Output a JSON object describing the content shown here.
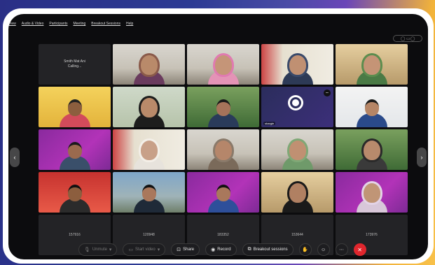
{
  "menu": [
    "View",
    "Audio & Video",
    "Participants",
    "Meeting",
    "Breakout Sessions",
    "Help"
  ],
  "view_toggle": "◯ ▭◯",
  "tiles": [
    {
      "kind": "name",
      "name": "Smith Mat Ani",
      "sub": "Calling...",
      "bg": "bg-dark"
    },
    {
      "kind": "person",
      "bg": "bg-room",
      "skin": "#b98a6a",
      "top": "#6a3b5e",
      "hijab": true,
      "tone": "#8a5a4a"
    },
    {
      "kind": "person",
      "bg": "bg-room",
      "skin": "#c59578",
      "top": "#e493b6",
      "hijab": true,
      "tone": "#e07ab0"
    },
    {
      "kind": "person",
      "bg": "bg-shelf",
      "skin": "#c09072",
      "top": "#2d3a56",
      "hijab": true,
      "tone": "#3a4a6a"
    },
    {
      "kind": "person",
      "bg": "bg-warm",
      "skin": "#c59476",
      "top": "#4a7a45",
      "hijab": true,
      "tone": "#5c8d4e"
    },
    {
      "kind": "person",
      "bg": "bg-yellow",
      "skin": "#8c5e3e",
      "top": "#d24b5b",
      "hijab": false,
      "tone": "#222"
    },
    {
      "kind": "person",
      "bg": "bg-office",
      "skin": "#b98a6a",
      "top": "#1d1d1d",
      "hijab": true,
      "tone": "#1d1d1d"
    },
    {
      "kind": "person",
      "bg": "bg-green",
      "skin": "#a6735a",
      "top": "#2a3b5a",
      "hijab": false,
      "tone": "#1a1a1a"
    },
    {
      "kind": "obs",
      "bg": "bg-dark",
      "tag": "shargie"
    },
    {
      "kind": "person",
      "bg": "bg-bike",
      "skin": "#b58566",
      "top": "#2a4a8a",
      "hijab": false,
      "tone": "#1a1a1a"
    },
    {
      "kind": "person",
      "bg": "bg-purple",
      "skin": "#9b6a4e",
      "top": "#3a4f6a",
      "hijab": false,
      "tone": "#1a1a1a"
    },
    {
      "kind": "person",
      "bg": "bg-shelf",
      "skin": "#c8a088",
      "top": "#e7e3dc",
      "hijab": true,
      "tone": "#f3efe8"
    },
    {
      "kind": "person",
      "bg": "bg-room",
      "skin": "#b5866a",
      "top": "#7a6a5a",
      "hijab": true,
      "tone": "#8a7a6a"
    },
    {
      "kind": "person",
      "bg": "bg-room",
      "skin": "#c09072",
      "top": "#6f9a6a",
      "hijab": true,
      "tone": "#7fa876"
    },
    {
      "kind": "person",
      "bg": "bg-green",
      "skin": "#b88a6c",
      "top": "#3a3a3a",
      "hijab": true,
      "tone": "#2a2a2a"
    },
    {
      "kind": "person",
      "bg": "bg-red",
      "skin": "#8c5e3e",
      "top": "#2b2b2b",
      "hijab": false,
      "tone": "#111"
    },
    {
      "kind": "person",
      "bg": "bg-sky",
      "skin": "#a9785c",
      "top": "#1f2a38",
      "hijab": false,
      "tone": "#111"
    },
    {
      "kind": "person",
      "bg": "bg-purple",
      "skin": "#a9785c",
      "top": "#2e4f9a",
      "hijab": false,
      "tone": "#111"
    },
    {
      "kind": "person",
      "bg": "bg-warm",
      "skin": "#b08062",
      "top": "#1a1a1a",
      "hijab": true,
      "tone": "#1a1a1a"
    },
    {
      "kind": "person",
      "bg": "bg-purple",
      "skin": "#c09576",
      "top": "#d8c7d9",
      "hijab": true,
      "tone": "#e3d3e6"
    },
    {
      "kind": "num",
      "num": "157916"
    },
    {
      "kind": "num",
      "num": "120948"
    },
    {
      "kind": "num",
      "num": "183352"
    },
    {
      "kind": "num",
      "num": "153644"
    },
    {
      "kind": "num",
      "num": "173976"
    }
  ],
  "toolbar": {
    "mute": "Unmute",
    "video": "Start video",
    "share": "Share",
    "record": "Record",
    "breakout": "Breakout sessions"
  }
}
